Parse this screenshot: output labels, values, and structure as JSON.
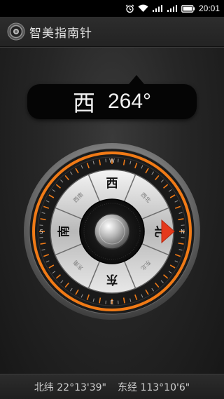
{
  "status_bar": {
    "time": "20:01",
    "icons": [
      "alarm-icon",
      "wifi-icon",
      "signal-icon",
      "signal-icon",
      "battery-icon"
    ]
  },
  "app": {
    "title": "智美指南针"
  },
  "heading": {
    "direction": "西",
    "degrees": "264°"
  },
  "compass": {
    "heading_degrees": 264,
    "dial_labels": [
      "西",
      "西北",
      "北",
      "东北",
      "东",
      "东南",
      "南",
      "西南"
    ],
    "ring_marks": [
      "W",
      "N",
      "E",
      "S"
    ],
    "accent_color": "#f07a16",
    "pointer_color": "#e5391b"
  },
  "coordinates": {
    "latitude": "北纬 22°13'39\"",
    "longitude": "东经 113°10'6\""
  }
}
